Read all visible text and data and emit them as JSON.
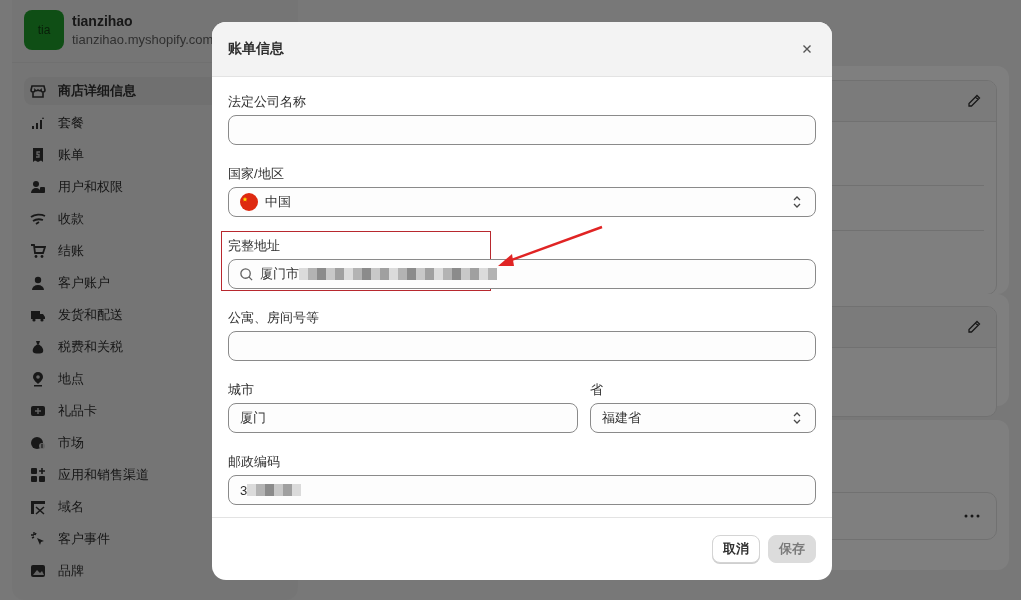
{
  "store": {
    "avatar": "tia",
    "name": "tianzihao",
    "domain": "tianzihao.myshopify.com"
  },
  "sidebar": {
    "items": [
      {
        "label": "商店详细信息",
        "selected": true
      },
      {
        "label": "套餐",
        "selected": false
      },
      {
        "label": "账单",
        "selected": false
      },
      {
        "label": "用户和权限",
        "selected": false
      },
      {
        "label": "收款",
        "selected": false
      },
      {
        "label": "结账",
        "selected": false
      },
      {
        "label": "客户账户",
        "selected": false
      },
      {
        "label": "发货和配送",
        "selected": false
      },
      {
        "label": "税费和关税",
        "selected": false
      },
      {
        "label": "地点",
        "selected": false
      },
      {
        "label": "礼品卡",
        "selected": false
      },
      {
        "label": "市场",
        "selected": false
      },
      {
        "label": "应用和销售渠道",
        "selected": false
      },
      {
        "label": "域名",
        "selected": false
      },
      {
        "label": "客户事件",
        "selected": false
      },
      {
        "label": "品牌",
        "selected": false
      }
    ]
  },
  "dialog": {
    "title": "账单信息",
    "rows": [
      [
        {
          "kind": "text",
          "label": "法定公司名称"
        }
      ],
      [
        {
          "kind": "country",
          "label": "国家/地区",
          "value": "中国"
        }
      ],
      [
        {
          "kind": "search",
          "label": "完整地址",
          "value": "厦门市",
          "redacted": true,
          "highlighted": true
        }
      ],
      [
        {
          "kind": "text",
          "label": "公寓、房间号等"
        }
      ],
      [
        {
          "kind": "text",
          "label": "城市",
          "value": "厦门"
        },
        {
          "kind": "select",
          "label": "省",
          "value": "福建省"
        }
      ],
      [
        {
          "kind": "text",
          "label": "邮政编码",
          "value": "3",
          "redacted": true
        }
      ]
    ],
    "buttons": [
      {
        "label": "取消",
        "disabled": false
      },
      {
        "label": "保存",
        "disabled": true
      }
    ]
  }
}
